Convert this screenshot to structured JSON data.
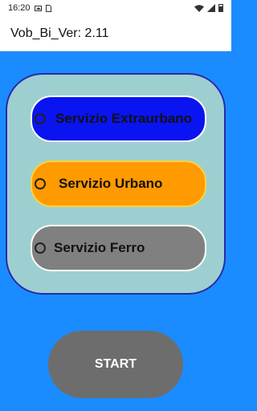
{
  "status_bar": {
    "time": "16:20",
    "icons": [
      "image-icon",
      "sim-card-icon",
      "wifi-icon",
      "signal-icon",
      "battery-icon"
    ]
  },
  "app_bar": {
    "title": "Vob_Bi_Ver: 2.11"
  },
  "options": [
    {
      "label": "Servizio Extraurbano",
      "color": "#0a14f0",
      "selected": false
    },
    {
      "label": "Servizio Urbano",
      "color": "#ff9a00",
      "selected": false
    },
    {
      "label": "Servizio Ferro",
      "color": "#808080",
      "selected": false
    }
  ],
  "start_button": {
    "label": "START"
  },
  "colors": {
    "background": "#1a8cff",
    "panel": "#9ecfd0",
    "panel_border": "#2a2aa8",
    "start_button": "#6d6d6d"
  }
}
